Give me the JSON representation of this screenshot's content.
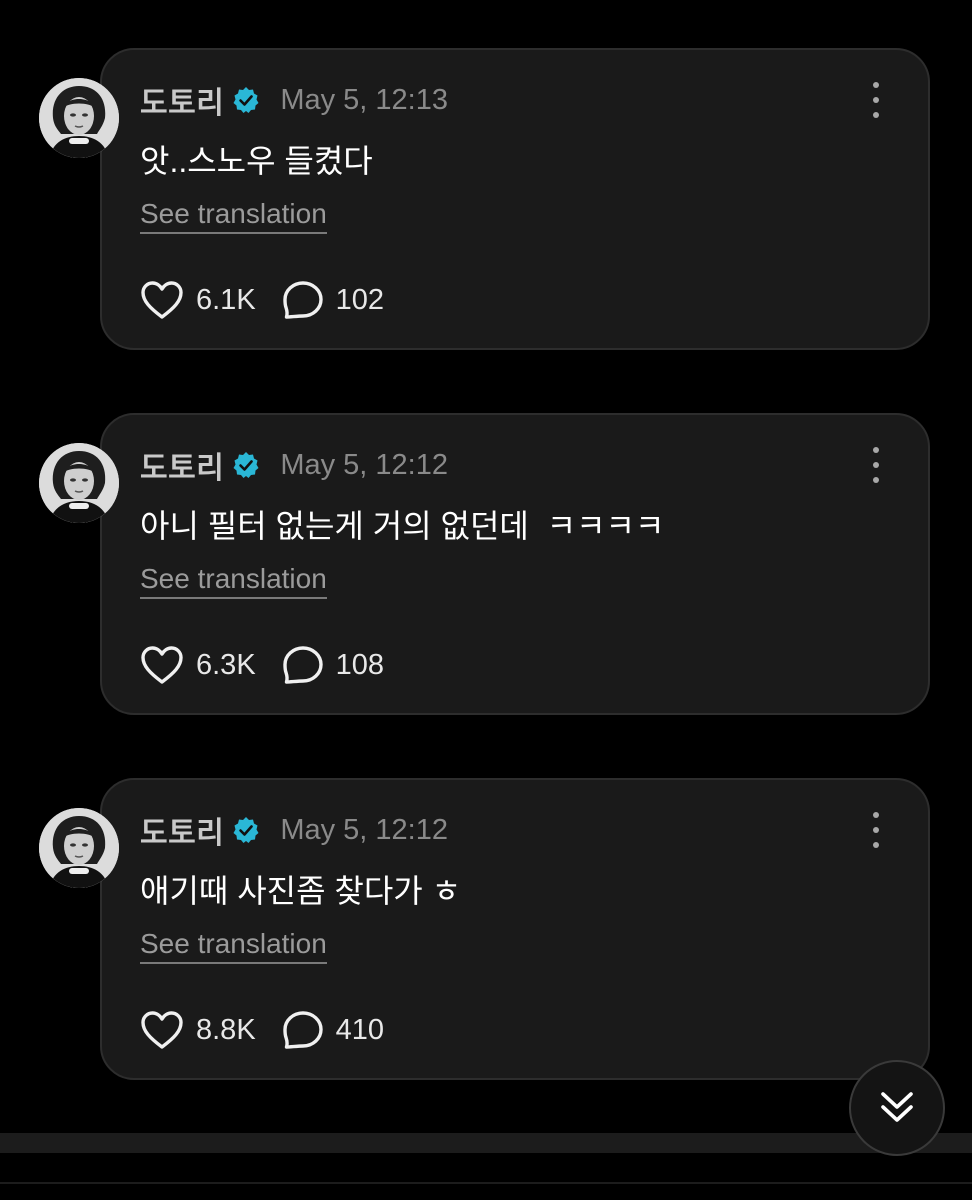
{
  "posts": [
    {
      "author": "도토리",
      "timestamp": "May 5, 12:13",
      "text": "앗..스노우 들켰다",
      "translate_label": "See translation",
      "likes": "6.1K",
      "comments": "102"
    },
    {
      "author": "도토리",
      "timestamp": "May 5, 12:12",
      "text": "아니 필터 없는게 거의 없던데  ㅋㅋㅋㅋ",
      "translate_label": "See translation",
      "likes": "6.3K",
      "comments": "108"
    },
    {
      "author": "도토리",
      "timestamp": "May 5, 12:12",
      "text": "애기때 사진좀 찾다가 ㅎ",
      "translate_label": "See translation",
      "likes": "8.8K",
      "comments": "410"
    }
  ],
  "icons": {
    "verified": "verified-badge-icon",
    "more": "more-vertical-icon",
    "like": "heart-icon",
    "comment": "comment-bubble-icon",
    "scroll": "double-chevron-down-icon"
  },
  "colors": {
    "background": "#000000",
    "card": "#1a1a1a",
    "verified": "#2ab7d6",
    "muted_text": "#8a8a8a"
  }
}
